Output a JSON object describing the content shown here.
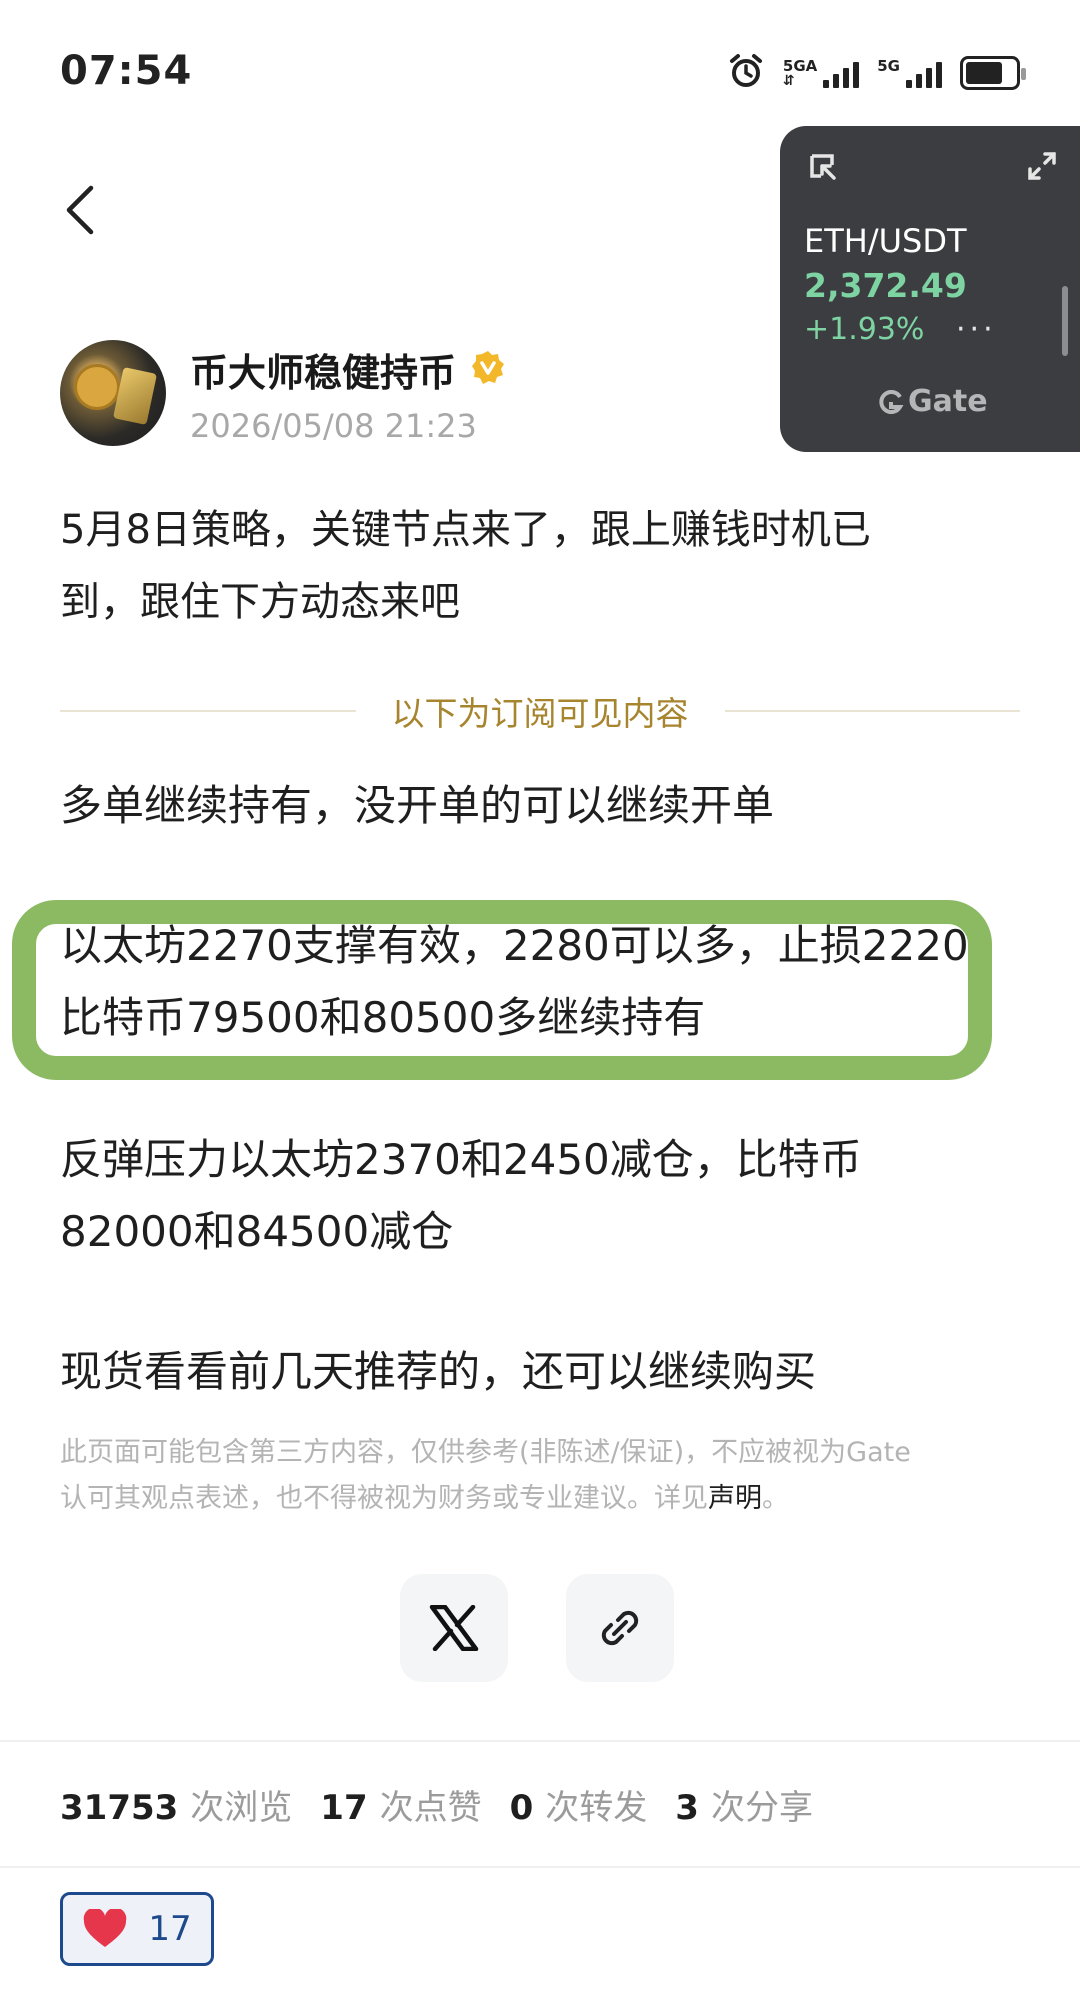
{
  "status_bar": {
    "time": "07:54",
    "network_1": "5GA",
    "network_2": "5G"
  },
  "ticker": {
    "pair": "ETH/USDT",
    "price": "2,372.49",
    "change": "+1.93%",
    "brand": "Gate",
    "up_color": "#7ed3a3"
  },
  "author": {
    "name": "币大师稳健持币",
    "date": "2026/05/08 21:23",
    "verified_badge_color": "#f3b829"
  },
  "post": {
    "title_line_1": "5月8日策略，关键节点来了，跟上赚钱时机已",
    "title_line_2": "到，跟住下方动态来吧",
    "subscription_divider": "以下为订阅可见内容",
    "para_1": "多单继续持有，没开单的可以继续开单",
    "para_2_line_1": "以太坊2270支撑有效，2280可以多，止损2220",
    "para_2_line_2": "比特币79500和80500多继续持有",
    "para_3_line_1": "反弹压力以太坊2370和2450减仓，比特币",
    "para_3_line_2": "82000和84500减仓",
    "para_4": "现货看看前几天推荐的，还可以继续购买",
    "highlight_color": "#8cba63"
  },
  "disclaimer": {
    "text_line_1": "此页面可能包含第三方内容，仅供参考(非陈述/保证)，不应被视为Gate",
    "text_line_2": "认可其观点表述，也不得被视为财务或专业建议。详见",
    "link": "声明",
    "end": "。"
  },
  "share": {
    "x_icon": "x-logo-icon",
    "link_icon": "link-icon"
  },
  "stats": {
    "views": "31753",
    "views_label": "次浏览",
    "likes": "17",
    "likes_label": "次点赞",
    "reposts": "0",
    "reposts_label": "次转发",
    "shares": "3",
    "shares_label": "次分享"
  },
  "like_button": {
    "count": "17",
    "heart_color": "#e5364b"
  }
}
